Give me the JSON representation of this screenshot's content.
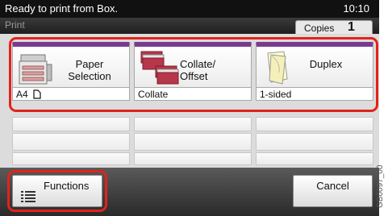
{
  "status_bar": {
    "message": "Ready to print from Box.",
    "time": "10:10"
  },
  "title_bar": {
    "title": "Print",
    "copies_label": "Copies",
    "copies_value": "1"
  },
  "tiles": [
    {
      "label_line1": "Paper",
      "label_line2": "Selection",
      "value": "A4",
      "icon": "printer-paper-icon",
      "value_icon": "portrait-page-icon"
    },
    {
      "label_line1": "Collate/",
      "label_line2": "Offset",
      "value": "Collate",
      "icon": "collate-stack-icon"
    },
    {
      "label_line1": "Duplex",
      "label_line2": "",
      "value": "1-sided",
      "icon": "duplex-page-icon"
    }
  ],
  "buttons": {
    "functions": "Functions",
    "cancel": "Cancel"
  },
  "figure_code": "GB0097_00",
  "colors": {
    "highlight": "#e2231a",
    "tile_accent": "#7a3b8f",
    "status_bg": "#111111"
  }
}
